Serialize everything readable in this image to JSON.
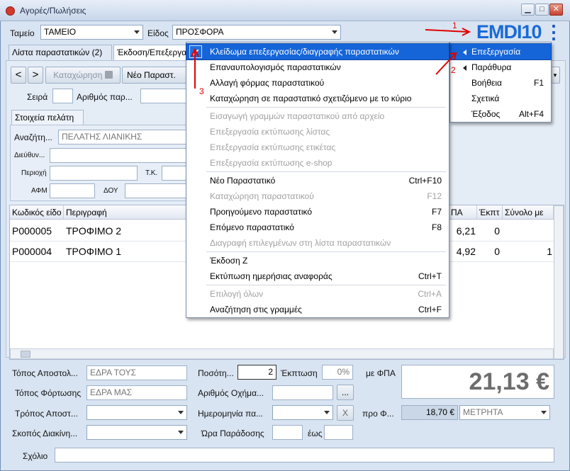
{
  "window": {
    "title": "Αγορές/Πωλήσεις",
    "min": "▁",
    "max": "□",
    "close": "✕"
  },
  "header": {
    "tameio_label": "Ταμείο",
    "tameio_value": "ΤΑΜΕΙΟ",
    "eidos_label": "Είδος",
    "eidos_value": "ΠΡΟΣΦΟΡΑ",
    "logo": "EMDI10",
    "kebab": "⋮"
  },
  "tabs": [
    "Λίστα παραστατικών (2)",
    "Έκδοση/Επεξεργασία"
  ],
  "toolbar": {
    "back": "<",
    "fwd": ">",
    "save": "Καταχώρηση",
    "new_doc": "Νέο Παραστ."
  },
  "doc": {
    "series_label": "Σειρά",
    "number_label": "Αριθμός παρ..."
  },
  "customer": {
    "tab": "Στοιχεία πελάτη",
    "search_label": "Αναζήτη...",
    "search_value": "ΠΕΛΑΤΗΣ ΛΙΑΝΙΚΗΣ",
    "address_label": "Διεύθυν...",
    "area_label": "Περιοχή",
    "zip_label": "Τ.Κ.",
    "afm_label": "ΑΦΜ",
    "doy_label": "ΔΟΥ"
  },
  "grid": {
    "headers": [
      "Κωδικός είδο",
      "Περιγραφή",
      "ΠΑ",
      "Έκπτ",
      "Σύνολο με"
    ],
    "rows": [
      {
        "code": "P000005",
        "desc": "ΤΡΟΦΙΜΟ 2",
        "price": "6,21",
        "disc": "0",
        "total": ""
      },
      {
        "code": "P000004",
        "desc": "ΤΡΟΦΙΜΟ 1",
        "price": "4,92",
        "disc": "0",
        "total": "1"
      }
    ]
  },
  "footer": {
    "ship_from_label": "Τόπος Αποστολ...",
    "ship_from_value": "ΕΔΡΑ ΤΟΥΣ",
    "load_label": "Τόπος Φόρτωσης",
    "load_value": "ΕΔΡΑ ΜΑΣ",
    "ship_method_label": "Τρόπος Αποστ...",
    "purpose_label": "Σκοπός Διακίνη...",
    "qty_label": "Ποσότη...",
    "qty_value": "2",
    "discount_label": "Έκπτωση",
    "discount_value": "0%",
    "vehicle_label": "Αριθμός Οχήμα...",
    "vehicle_btn": "...",
    "date_label": "Ημερομηνία πα...",
    "date_clear": "X",
    "time_label": "Ώρα Παράδοσης",
    "time_to_label": "έως",
    "with_vat_label": "με ΦΠΑ",
    "total": "21,13 €",
    "pre_vat_label": "προ Φ...",
    "pre_vat_value": "18,70 €",
    "payment_value": "ΜΕΤΡΗΤΑ",
    "comment_label": "Σχόλιο"
  },
  "edit_menu": {
    "items": [
      {
        "label": "Κλείδωμα επεξεργασίας/διαγραφής παραστατικών",
        "shortcut": "",
        "checked": true
      },
      {
        "label": "Επαναυπολογισμός παραστατικών",
        "shortcut": ""
      },
      {
        "label": "Αλλαγή φόρμας παραστατικού",
        "shortcut": ""
      },
      {
        "label": "Καταχώρηση σε παραστατικό σχετιζόμενο με το κύριο",
        "shortcut": ""
      },
      {
        "label": "Εισαγωγή γραμμών παραστατικού από αρχείο",
        "shortcut": ""
      },
      {
        "label": "Επεξεργασία εκτύπωσης λίστας",
        "shortcut": ""
      },
      {
        "label": "Επεξεργασία εκτύπωσης ετικέτας",
        "shortcut": ""
      },
      {
        "label": "Επεξεργασία εκτύπωσης e-shop",
        "shortcut": ""
      },
      {
        "label": "Νέο Παραστατικό",
        "shortcut": "Ctrl+F10"
      },
      {
        "label": "Καταχώρηση παραστατικού",
        "shortcut": "F12"
      },
      {
        "label": "Προηγούμενο παραστατικό",
        "shortcut": "F7"
      },
      {
        "label": "Επόμενο παραστατικό",
        "shortcut": "F8"
      },
      {
        "label": "Διαγραφή επιλεγμένων στη λίστα παραστατικών",
        "shortcut": ""
      },
      {
        "label": "Έκδοση Ζ",
        "shortcut": ""
      },
      {
        "label": "Εκτύπωση ημερήσιας αναφοράς",
        "shortcut": "Ctrl+T"
      },
      {
        "label": "Επιλογή όλων",
        "shortcut": "Ctrl+A"
      },
      {
        "label": "Αναζήτηση στις γραμμές",
        "shortcut": "Ctrl+F"
      }
    ],
    "check": "✔"
  },
  "main_menu": {
    "items": [
      {
        "label": "Επεξεργασία",
        "shortcut": ""
      },
      {
        "label": "Παράθυρα",
        "shortcut": ""
      },
      {
        "label": "Βοήθεια",
        "shortcut": "F1"
      },
      {
        "label": "Σχετικά",
        "shortcut": ""
      },
      {
        "label": "Έξοδος",
        "shortcut": "Alt+F4"
      }
    ]
  },
  "annotations": {
    "n1": "1",
    "n2": "2",
    "n3": "3",
    "color": "#e00000"
  }
}
